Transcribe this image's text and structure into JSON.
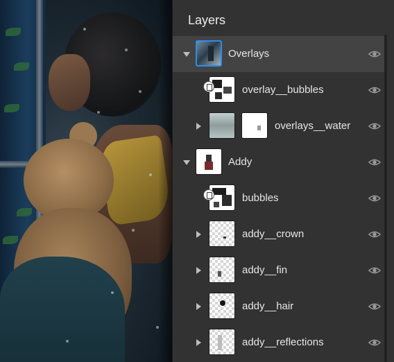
{
  "panel": {
    "title": "Layers"
  },
  "layers": [
    {
      "name": "Overlays",
      "kind": "group",
      "expanded": true,
      "selected": true
    },
    {
      "name": "overlay__bubbles",
      "kind": "layer",
      "clipped": true
    },
    {
      "name": "overlays__water",
      "kind": "layer-with-mask",
      "expanded": false
    },
    {
      "name": "Addy",
      "kind": "group",
      "expanded": true
    },
    {
      "name": "bubbles",
      "kind": "layer",
      "clipped": true
    },
    {
      "name": "addy__crown",
      "kind": "group",
      "expanded": false
    },
    {
      "name": "addy__fin",
      "kind": "group",
      "expanded": false
    },
    {
      "name": "addy__hair",
      "kind": "group",
      "expanded": false
    },
    {
      "name": "addy__reflections",
      "kind": "group",
      "expanded": false
    }
  ],
  "icons": {
    "visibility": "eye-icon",
    "expand": "caret-icon",
    "clipping": "clipping-mask-icon"
  },
  "colors": {
    "panel_bg": "#323232",
    "selected_row_bg": "#434343",
    "selection_border": "#2d8ceb",
    "text": "#e6e6e6"
  }
}
